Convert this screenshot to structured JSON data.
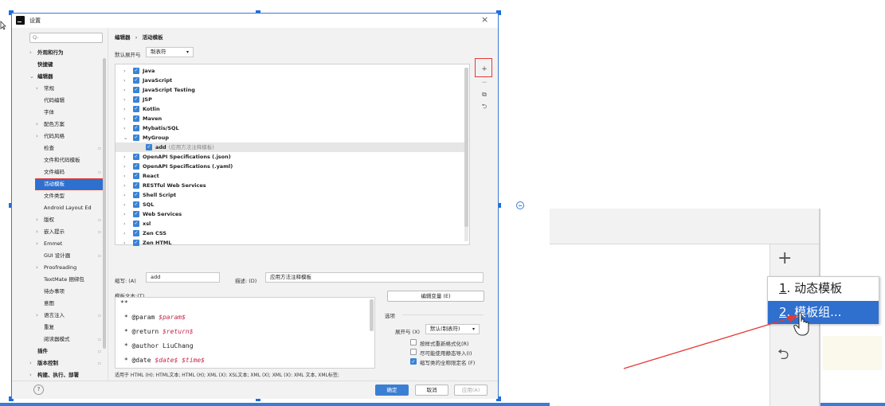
{
  "dialog": {
    "title": "设置",
    "close_glyph": "×",
    "search_placeholder": "Q-",
    "breadcrumb": [
      "编辑器",
      "活动模板"
    ],
    "breadcrumb_sep": "›",
    "expand_label": "默认展开与",
    "expand_value": "制表符"
  },
  "sidebar": {
    "items": [
      {
        "label": "外观和行为",
        "chev": "›",
        "bold": true
      },
      {
        "label": "快捷键",
        "chev": "",
        "bold": true
      },
      {
        "label": "编辑器",
        "chev": "⌄",
        "bold": true
      },
      {
        "label": "常规",
        "chev": "›"
      },
      {
        "label": "代码编辑",
        "chev": ""
      },
      {
        "label": "字体",
        "chev": ""
      },
      {
        "label": "配色方案",
        "chev": "›"
      },
      {
        "label": "代码风格",
        "chev": "›"
      },
      {
        "label": "检查",
        "chev": "",
        "pin": true
      },
      {
        "label": "文件和代码模板",
        "chev": ""
      },
      {
        "label": "文件编码",
        "chev": "",
        "pin": true
      },
      {
        "label": "活动模板",
        "chev": "",
        "selected": true
      },
      {
        "label": "文件类型",
        "chev": ""
      },
      {
        "label": "Android Layout Ed",
        "chev": ""
      },
      {
        "label": "版权",
        "chev": "›",
        "pin": true
      },
      {
        "label": "嵌入提示",
        "chev": "›",
        "pin": true
      },
      {
        "label": "Emmet",
        "chev": "›"
      },
      {
        "label": "GUI 设计器",
        "chev": "",
        "pin": true
      },
      {
        "label": "Proofreading",
        "chev": "›"
      },
      {
        "label": "TextMate 捆绑包",
        "chev": ""
      },
      {
        "label": "待办事项",
        "chev": ""
      },
      {
        "label": "意图",
        "chev": ""
      },
      {
        "label": "语言注入",
        "chev": "›",
        "pin": true
      },
      {
        "label": "重复",
        "chev": ""
      },
      {
        "label": "阅读器模式",
        "chev": "",
        "pin": true
      },
      {
        "label": "插件",
        "chev": "",
        "bold": true,
        "pin": true
      },
      {
        "label": "版本控制",
        "chev": "›",
        "bold": true,
        "pin": true
      },
      {
        "label": "构建、执行、部署",
        "chev": "›",
        "bold": true
      }
    ]
  },
  "templates": {
    "groups": [
      {
        "name": "Java",
        "chev": "›"
      },
      {
        "name": "JavaScript",
        "chev": "›"
      },
      {
        "name": "JavaScript Testing",
        "chev": "›"
      },
      {
        "name": "JSP",
        "chev": "›"
      },
      {
        "name": "Kotlin",
        "chev": "›"
      },
      {
        "name": "Maven",
        "chev": "›"
      },
      {
        "name": "Mybatis/SQL",
        "chev": "›"
      },
      {
        "name": "MyGroup",
        "chev": "⌄"
      },
      {
        "name": "add",
        "desc": "(应用方法注释模板)",
        "child": true
      },
      {
        "name": "OpenAPI Specifications (.json)",
        "chev": "›"
      },
      {
        "name": "OpenAPI Specifications (.yaml)",
        "chev": "›"
      },
      {
        "name": "React",
        "chev": "›"
      },
      {
        "name": "RESTful Web Services",
        "chev": "›"
      },
      {
        "name": "Shell Script",
        "chev": "›"
      },
      {
        "name": "SQL",
        "chev": "›"
      },
      {
        "name": "Web Services",
        "chev": "›"
      },
      {
        "name": "xsl",
        "chev": "›"
      },
      {
        "name": "Zen CSS",
        "chev": "›"
      },
      {
        "name": "Zen HTML",
        "chev": "›"
      }
    ],
    "check_glyph": "✓"
  },
  "toolbar": {
    "add": "+",
    "remove": "−",
    "copy": "⧉",
    "restore": "⮌"
  },
  "edit": {
    "abbr_label": "缩写: (A)",
    "abbr_value": "add",
    "desc_label": "描述: (D)",
    "desc_value": "应用方法注释模板",
    "template_text_label": "模板文本:(T)",
    "edit_vars_button": "编辑变量 (E)",
    "code_lines": [
      {
        "pre": "**",
        "var": ""
      },
      {
        "pre": " * @param ",
        "var": "$param$"
      },
      {
        "pre": " * @return ",
        "var": "$return$"
      },
      {
        "pre": " * @author LiuChang",
        "var": ""
      },
      {
        "pre": " * @date ",
        "var": "$date$ $time$"
      }
    ],
    "applicable_text": "适用于 HTML (H): HTML文本; HTML (H); XML (X): XSL文本; XML (X); XML (X): XML 文本, XML标签;"
  },
  "options": {
    "title": "选项",
    "expand_label": "展开与 (X)",
    "expand_value": "默认(制表符)",
    "checks": [
      {
        "label": "按样式重新格式化(R)",
        "checked": false
      },
      {
        "label": "尽可能使用静态导入(I)",
        "checked": false
      },
      {
        "label": "缩写类的全称限定名 (F)",
        "checked": true
      }
    ]
  },
  "footer": {
    "help": "?",
    "ok": "确定",
    "cancel": "取消",
    "apply": "应用(A)"
  },
  "zoom": {
    "add": "+",
    "restore": "⮌",
    "menu_items": [
      {
        "num": "1",
        "label": ". 动态模板"
      },
      {
        "num": "2",
        "label": ". 模板组..."
      }
    ]
  },
  "colors": {
    "accent": "#2f6fce",
    "highlight_box": "#e53935",
    "selection": "#3b7fd4"
  }
}
